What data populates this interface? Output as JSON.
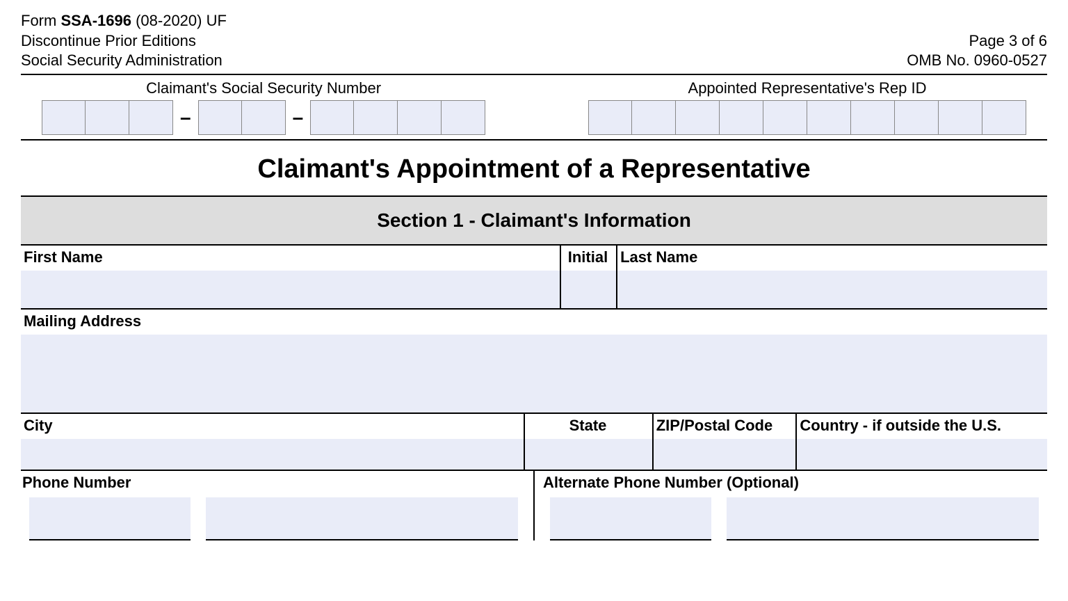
{
  "header": {
    "form_prefix": "Form ",
    "form_number": "SSA-1696",
    "form_suffix": " (08-2020) UF",
    "line2": "Discontinue Prior Editions",
    "line3": "Social Security Administration",
    "page": "Page 3 of 6",
    "omb": "OMB No. 0960-0527"
  },
  "id_section": {
    "ssn_label": "Claimant's Social Security Number",
    "rep_label": "Appointed Representative's Rep ID"
  },
  "main_title": "Claimant's Appointment of a Representative",
  "section1": {
    "title": "Section 1 - Claimant's Information",
    "first_name": "First Name",
    "initial": "Initial",
    "last_name": "Last Name",
    "mailing": "Mailing Address",
    "city": "City",
    "state": "State",
    "zip": "ZIP/Postal Code",
    "country": "Country - if outside the U.S.",
    "phone": "Phone Number",
    "alt_phone": "Alternate Phone Number (Optional)"
  }
}
